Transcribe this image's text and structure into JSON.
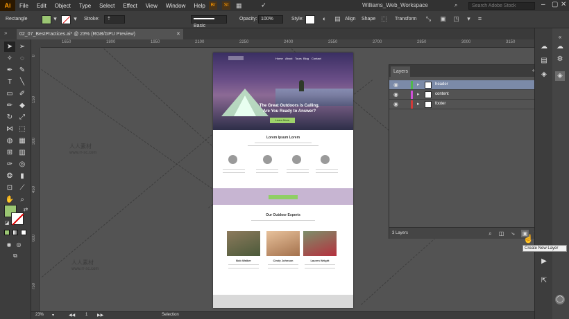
{
  "app": {
    "logo": "Ai",
    "workspace": "Williams_Web_Workspace",
    "search_placeholder": "Search Adobe Stock"
  },
  "menu": [
    "File",
    "Edit",
    "Object",
    "Type",
    "Select",
    "Effect",
    "View",
    "Window",
    "Help"
  ],
  "control": {
    "selection_type": "Rectangle",
    "stroke_label": "Stroke:",
    "brush": "Basic",
    "opacity_label": "Opacity:",
    "opacity_value": "100%",
    "style_label": "Style:",
    "align_label": "Align",
    "shape_label": "Shape",
    "transform_label": "Transform",
    "fill_color": "#9bc673"
  },
  "document": {
    "tab_title": "02_07_BestPractices.ai* @ 23% (RGB/GPU Preview)"
  },
  "ruler_h": [
    "1650",
    "1800",
    "1950",
    "2100",
    "2250",
    "2400",
    "2550",
    "2700",
    "2850",
    "3000",
    "3150"
  ],
  "ruler_v": [
    "0",
    "150",
    "300",
    "450",
    "600",
    "750"
  ],
  "artboard": {
    "nav": [
      "Home",
      "About",
      "Tours",
      "Blog",
      "Contact"
    ],
    "hero_title_1": "The Great Outdoors is Calling.",
    "hero_title_2": "Are You Ready to Answer?",
    "hero_cta": "Learn More",
    "section1_title": "Lorem Ipsum Lorem",
    "section2_title": "Our Outdoor Experts",
    "experts": [
      "Bob Walker",
      "Cindy Johnson",
      "Lauren Wright"
    ]
  },
  "layers": {
    "tab": "Layers",
    "items": [
      {
        "name": "header",
        "color": "#4fb84a",
        "selected": true
      },
      {
        "name": "content",
        "color": "#d04fd8",
        "selected": false
      },
      {
        "name": "footer",
        "color": "#d13a3a",
        "selected": false
      }
    ],
    "count": "3 Layers",
    "tooltip": "Create New Layer"
  },
  "status": {
    "zoom": "23%",
    "page": "1",
    "tool": "Selection"
  },
  "watermark": {
    "text": "人人素材",
    "url": "www.rr-sc.com"
  }
}
